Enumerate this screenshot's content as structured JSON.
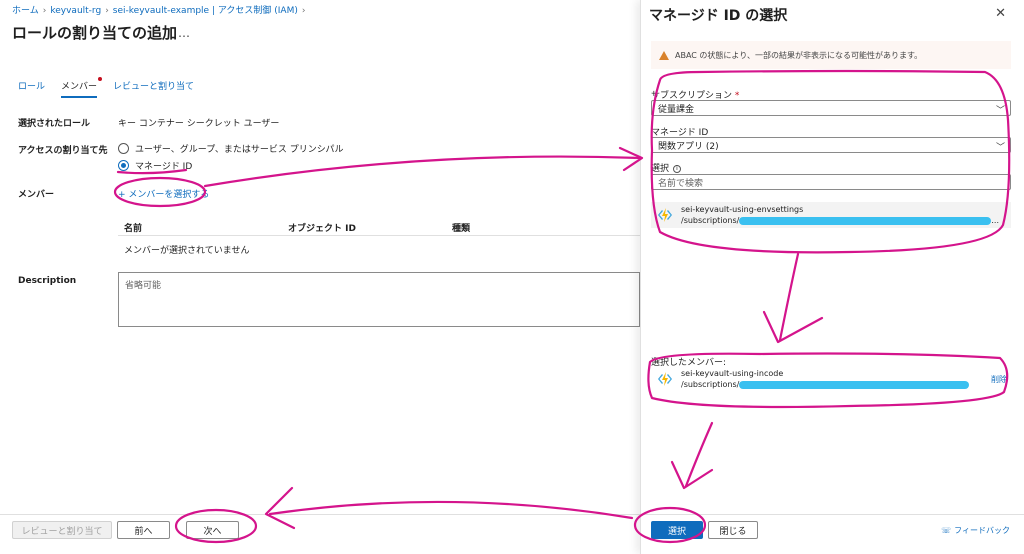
{
  "breadcrumb": [
    "ホーム",
    "keyvault-rg",
    "sei-keyvault-example | アクセス制御 (IAM)"
  ],
  "page_title": "ロールの割り当ての追加",
  "title_more": "…",
  "tabs": [
    {
      "label": "ロール",
      "active": false
    },
    {
      "label": "メンバー",
      "active": true
    },
    {
      "label": "レビューと割り当て",
      "active": false
    }
  ],
  "form": {
    "selected_role_label": "選択されたロール",
    "selected_role_value": "キー コンテナー シークレット ユーザー",
    "assign_access_label": "アクセスの割り当て先",
    "option_user": "ユーザー、グループ、またはサービス プリンシパル",
    "option_managed": "マネージド ID",
    "members_label": "メンバー",
    "select_members_link": "+ メンバーを選択する",
    "table_headers": [
      "名前",
      "オブジェクト ID",
      "種類"
    ],
    "empty_row": "メンバーが選択されていません",
    "description_label": "Description",
    "description_placeholder": "省略可能"
  },
  "footer": {
    "review_assign": "レビューと割り当て",
    "prev": "前へ",
    "next": "次へ"
  },
  "panel": {
    "title": "マネージド ID の選択",
    "warning": "ABAC の状態により、一部の結果が非表示になる可能性があります。",
    "subscription_label": "サブスクリプション",
    "subscription_required": "*",
    "subscription_value": "従量課金",
    "managed_id_label": "マネージド ID",
    "managed_id_value": "関数アプリ (2)",
    "select_label": "選択",
    "search_placeholder": "名前で検索",
    "result_name": "sei-keyvault-using-envsettings",
    "result_path": "/subscriptions/",
    "result_ellipsis": "...",
    "selected_members_label": "選択したメンバー:",
    "selected_name": "sei-keyvault-using-incode",
    "selected_path": "/subscriptions/",
    "remove": "削除",
    "select_button": "選択",
    "close_button": "閉じる",
    "feedback": "フィードバック"
  },
  "colors": {
    "accent": "#0f6cbd",
    "annotation": "#d4148c",
    "redaction": "#3ac0f0"
  }
}
